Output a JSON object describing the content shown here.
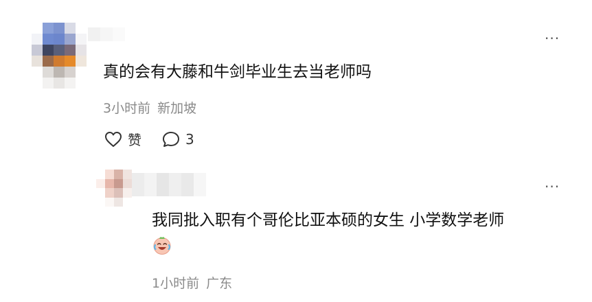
{
  "theme": {
    "text_color": "#111111",
    "meta_color": "#8a8a8a",
    "background": "#ffffff"
  },
  "comment": {
    "text": "真的会有大藤和牛剑毕业生去当老师吗",
    "time": "3小时前",
    "location": "新加坡",
    "like_label": "赞",
    "reply_count": "3",
    "more_icon": "more-horizontal-icon",
    "avatar_colors": [
      "#ffffff",
      "#8aa0d8",
      "#7d93cf",
      "#d9dbe6",
      "#ffffff",
      "#f2f3f7",
      "#6f8ad0",
      "#6c86cc",
      "#9aa6cf",
      "#f4f4f6",
      "#c8c9d6",
      "#3e4560",
      "#595f7a",
      "#7a6a78",
      "#e6e3e6",
      "#e8e2dc",
      "#9b6b4b",
      "#d07b2f",
      "#e58a2a",
      "#efe6dc",
      "#ffffff",
      "#dedbd8",
      "#bdb7b2",
      "#d7d2cf",
      "#ffffff",
      "#ffffff",
      "#f3f2f1",
      "#e8e6e4",
      "#f4f3f2",
      "#ffffff"
    ]
  },
  "reply": {
    "text": "我同批入职有个哥伦比亚本硕的女生 小学数学老师",
    "emoji": "crying-laughing-emoji",
    "time": "1小时前",
    "location": "广东",
    "more_icon": "more-horizontal-icon",
    "avatar_colors": [
      "#ffffff",
      "#f6ddd5",
      "#d9b3a8",
      "#f0e4e0",
      "#fbeeea",
      "#e7b7ab",
      "#c89a8f",
      "#ecdcd7",
      "#ffffff",
      "#efd2c9",
      "#dcc0b9",
      "#f7efec",
      "#ffffff",
      "#fbf7f5",
      "#eee6e3",
      "#ffffff"
    ]
  }
}
